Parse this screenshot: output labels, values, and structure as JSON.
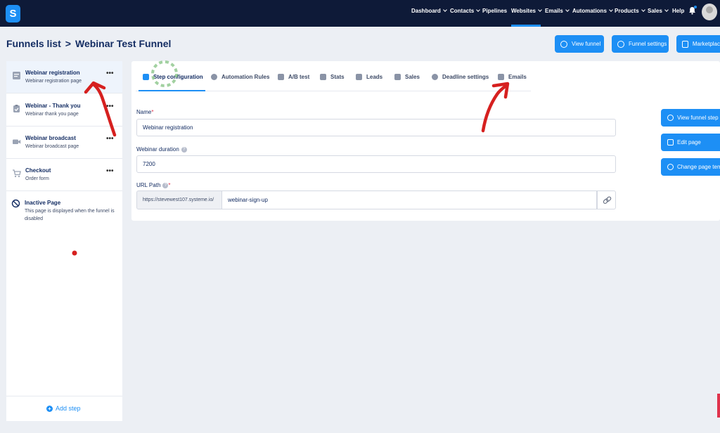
{
  "app": {
    "logo_letter": "S"
  },
  "topnav": {
    "items": [
      {
        "label": "Dashboard",
        "has_chevron": true
      },
      {
        "label": "Contacts",
        "has_chevron": true
      },
      {
        "label": "Pipelines",
        "has_chevron": false
      },
      {
        "label": "Websites",
        "has_chevron": true,
        "active": true
      },
      {
        "label": "Emails",
        "has_chevron": true
      },
      {
        "label": "Automations",
        "has_chevron": true
      },
      {
        "label": "Products",
        "has_chevron": true
      },
      {
        "label": "Sales",
        "has_chevron": true
      },
      {
        "label": "Help",
        "has_chevron": false
      }
    ],
    "accent": "#1d8ff5",
    "background": "#0e1a38"
  },
  "header": {
    "breadcrumb_parent": "Funnels list",
    "separator": ">",
    "breadcrumb_current": "Webinar Test Funnel",
    "buttons": {
      "view_funnel": "View funnel",
      "funnel_settings": "Funnel settings",
      "marketplace": "Marketplac"
    }
  },
  "sidebar": {
    "steps": [
      {
        "title": "Webinar registration",
        "subtitle": "Webinar registration page",
        "icon": "page-icon",
        "active": true,
        "menu": "•••"
      },
      {
        "title": "Webinar - Thank you",
        "subtitle": "Webinar thank you page",
        "icon": "clipboard-check-icon",
        "menu": "•••"
      },
      {
        "title": "Webinar broadcast",
        "subtitle": "Webinar broadcast page",
        "icon": "video-camera-icon",
        "menu": "•••"
      },
      {
        "title": "Checkout",
        "subtitle": "Order form",
        "icon": "cart-icon",
        "menu": "•••"
      }
    ],
    "inactive": {
      "title": "Inactive Page",
      "description": "This page is displayed when the funnel is disabled",
      "icon": "ban-icon"
    },
    "add_step": "Add step"
  },
  "tabs": [
    {
      "label": "Step configuration",
      "icon": "config-icon",
      "active": true
    },
    {
      "label": "Automation Rules",
      "icon": "bolt-icon"
    },
    {
      "label": "A/B test",
      "icon": "ab-test-icon"
    },
    {
      "label": "Stats",
      "icon": "stats-icon"
    },
    {
      "label": "Leads",
      "icon": "leads-icon"
    },
    {
      "label": "Sales",
      "icon": "dollar-icon"
    },
    {
      "label": "Deadline settings",
      "icon": "clock-icon"
    },
    {
      "label": "Emails",
      "icon": "mail-icon"
    }
  ],
  "form": {
    "name_label": "Name",
    "name_value": "Webinar registration",
    "duration_label": "Webinar duration",
    "duration_value": "7200",
    "url_label": "URL Path",
    "url_prefix": "https://stevewest107.systeme.io/",
    "url_value": "webinar-sign-up",
    "required_mark": "*",
    "help_mark": "?"
  },
  "side_actions": {
    "view_funnel_step": "View funnel step",
    "edit_page": "Edit page",
    "change_page_template": "Change page temp"
  }
}
